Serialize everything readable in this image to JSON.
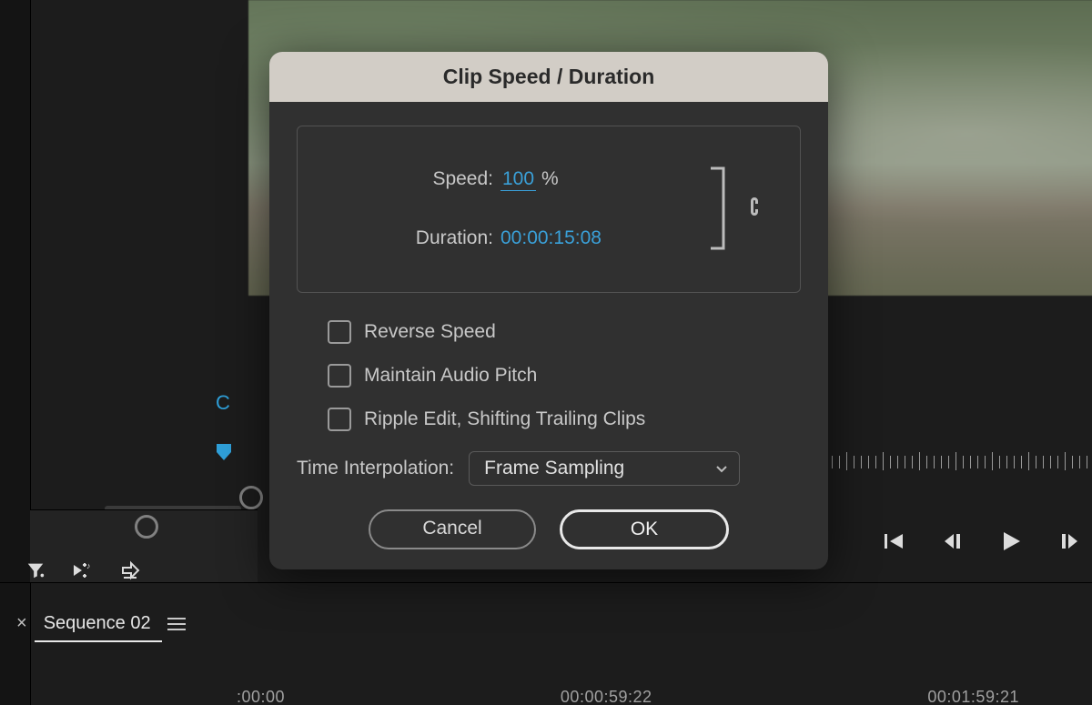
{
  "dialog": {
    "title": "Clip Speed / Duration",
    "speed_label": "Speed:",
    "speed_value": "100",
    "speed_unit": "%",
    "duration_label": "Duration:",
    "duration_value": "00:00:15:08",
    "reverse_label": "Reverse Speed",
    "pitch_label": "Maintain Audio Pitch",
    "ripple_label": "Ripple Edit, Shifting Trailing Clips",
    "interp_label": "Time Interpolation:",
    "interp_value": "Frame Sampling",
    "cancel_label": "Cancel",
    "ok_label": "OK"
  },
  "sequence": {
    "name": "Sequence 02"
  },
  "timeline": {
    "t0": ":00:00",
    "t1": "00:00:59:22",
    "t2": "00:01:59:21"
  },
  "fragment": {
    "blue_c": "C"
  }
}
